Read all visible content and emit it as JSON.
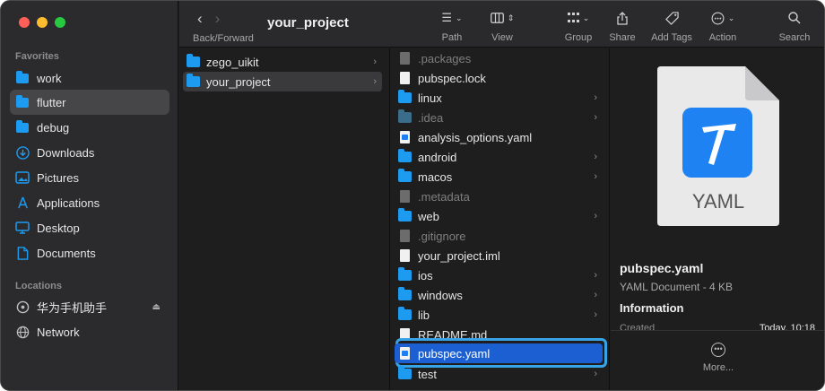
{
  "toolbar": {
    "back_forward_label": "Back/Forward",
    "title": "your_project",
    "groups": [
      {
        "label": "Path",
        "icon": "path-icon"
      },
      {
        "label": "View",
        "icon": "columns-view-icon"
      },
      {
        "label": "Group",
        "icon": "group-icon"
      },
      {
        "label": "Share",
        "icon": "share-icon"
      },
      {
        "label": "Add Tags",
        "icon": "tag-icon"
      },
      {
        "label": "Action",
        "icon": "action-icon"
      },
      {
        "label": "Search",
        "icon": "search-icon"
      }
    ]
  },
  "sidebar": {
    "favorites_label": "Favorites",
    "favorites": [
      {
        "label": "work",
        "icon": "folder-icon"
      },
      {
        "label": "flutter",
        "icon": "folder-icon",
        "selected": true
      },
      {
        "label": "debug",
        "icon": "folder-icon"
      },
      {
        "label": "Downloads",
        "icon": "downloads-icon"
      },
      {
        "label": "Pictures",
        "icon": "pictures-icon"
      },
      {
        "label": "Applications",
        "icon": "applications-icon"
      },
      {
        "label": "Desktop",
        "icon": "desktop-icon"
      },
      {
        "label": "Documents",
        "icon": "documents-icon"
      }
    ],
    "locations_label": "Locations",
    "locations": [
      {
        "label": "华为手机助手",
        "icon": "drive-icon",
        "ejectable": true
      },
      {
        "label": "Network",
        "icon": "network-icon"
      }
    ]
  },
  "column1": [
    {
      "label": "zego_uikit",
      "type": "folder"
    },
    {
      "label": "your_project",
      "type": "folder",
      "selected": true
    }
  ],
  "column2": [
    {
      "label": ".packages",
      "type": "file",
      "dim": true
    },
    {
      "label": "pubspec.lock",
      "type": "file"
    },
    {
      "label": "linux",
      "type": "folder"
    },
    {
      "label": ".idea",
      "type": "folder",
      "dim": true
    },
    {
      "label": "analysis_options.yaml",
      "type": "yaml"
    },
    {
      "label": "android",
      "type": "folder"
    },
    {
      "label": "macos",
      "type": "folder"
    },
    {
      "label": ".metadata",
      "type": "file",
      "dim": true
    },
    {
      "label": "web",
      "type": "folder"
    },
    {
      "label": ".gitignore",
      "type": "file",
      "dim": true
    },
    {
      "label": "your_project.iml",
      "type": "file"
    },
    {
      "label": "ios",
      "type": "folder"
    },
    {
      "label": "windows",
      "type": "folder"
    },
    {
      "label": "lib",
      "type": "folder"
    },
    {
      "label": "README.md",
      "type": "file"
    },
    {
      "label": "pubspec.yaml",
      "type": "yaml",
      "selected": true
    },
    {
      "label": "test",
      "type": "folder"
    }
  ],
  "preview": {
    "icon_label": "YAML",
    "name": "pubspec.yaml",
    "kind": "YAML Document - 4 KB",
    "information_label": "Information",
    "created_label": "Created",
    "created_value": "Today, 10:18",
    "more_label": "More..."
  },
  "colors": {
    "accent": "#1b5fd2",
    "focus_ring": "#37a4e8",
    "folder": "#1c9bf0"
  }
}
